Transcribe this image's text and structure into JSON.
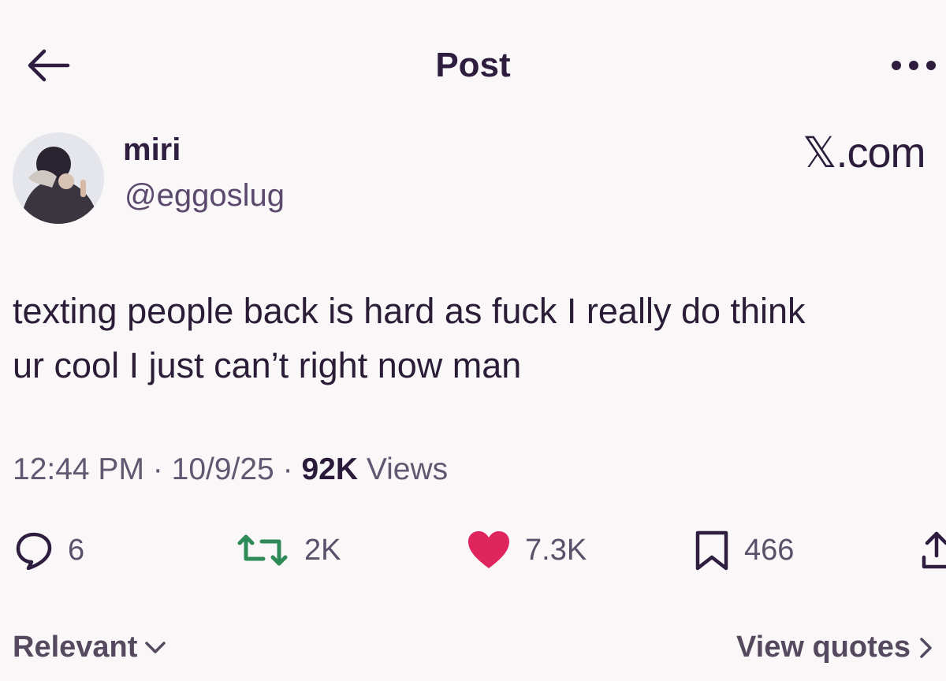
{
  "header": {
    "title": "Post",
    "back_icon": "arrow-left-icon",
    "more_icon": "more-horizontal-icon"
  },
  "author": {
    "name": "miri",
    "handle": "@eggoslug",
    "avatar_icon": "avatar-photo"
  },
  "brand": "𝕏.com",
  "post": {
    "text": "texting people back is hard as fuck I really do think\nur cool I just can’t right now man",
    "time": "12:44 PM",
    "date": "10/9/25",
    "views_count": "92K",
    "views_label": "Views",
    "separator": "·"
  },
  "actions": {
    "replies": "6",
    "reposts": "2K",
    "likes": "7.3K",
    "bookmarks": "466"
  },
  "colors": {
    "repost": "#2e8b57",
    "like": "#e0245e",
    "text": "#2b1d38"
  },
  "footer": {
    "sort_label": "Relevant",
    "quotes_label": "View quotes"
  }
}
